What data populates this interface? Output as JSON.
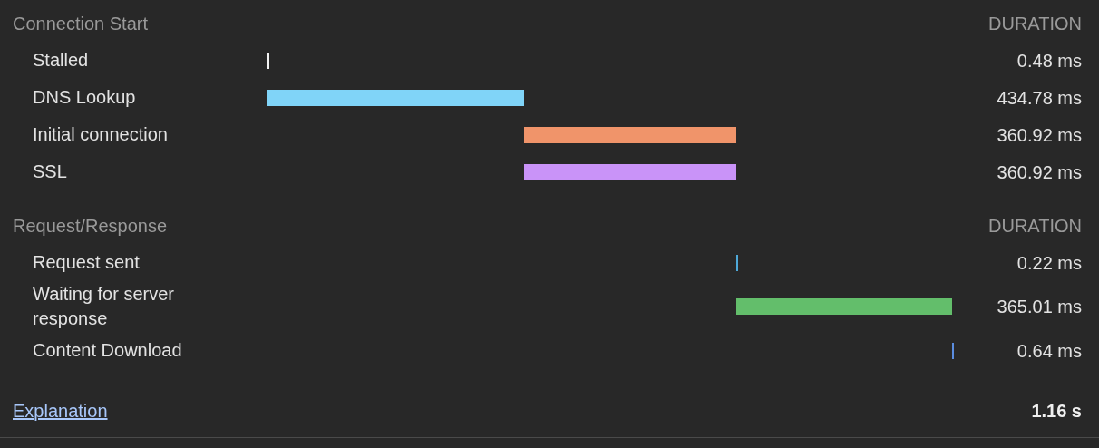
{
  "sections": [
    {
      "title": "Connection Start",
      "column_heading": "DURATION",
      "rows": [
        {
          "label": "Stalled",
          "duration": "0.48 ms",
          "kind": "next",
          "color": "#f2f2f2"
        },
        {
          "label": "DNS Lookup",
          "duration": "434.78 ms",
          "kind": "next",
          "color": "#80d4f8"
        },
        {
          "label": "Initial connection",
          "duration": "360.92 ms",
          "kind": "next",
          "color": "#f0946a"
        },
        {
          "label": "SSL",
          "duration": "360.92 ms",
          "kind": "sub",
          "color": "#c993f8"
        }
      ]
    },
    {
      "title": "Request/Response",
      "column_heading": "DURATION",
      "rows": [
        {
          "label": "Request sent",
          "duration": "0.22 ms",
          "kind": "next",
          "color": "#4ea8d8"
        },
        {
          "label": "Waiting for server response",
          "duration": "365.01 ms",
          "kind": "next",
          "color": "#63be6b"
        },
        {
          "label": "Content Download",
          "duration": "0.64 ms",
          "kind": "next",
          "color": "#5b8de0"
        }
      ]
    }
  ],
  "footer": {
    "link": "Explanation",
    "total": "1.16 s"
  }
}
